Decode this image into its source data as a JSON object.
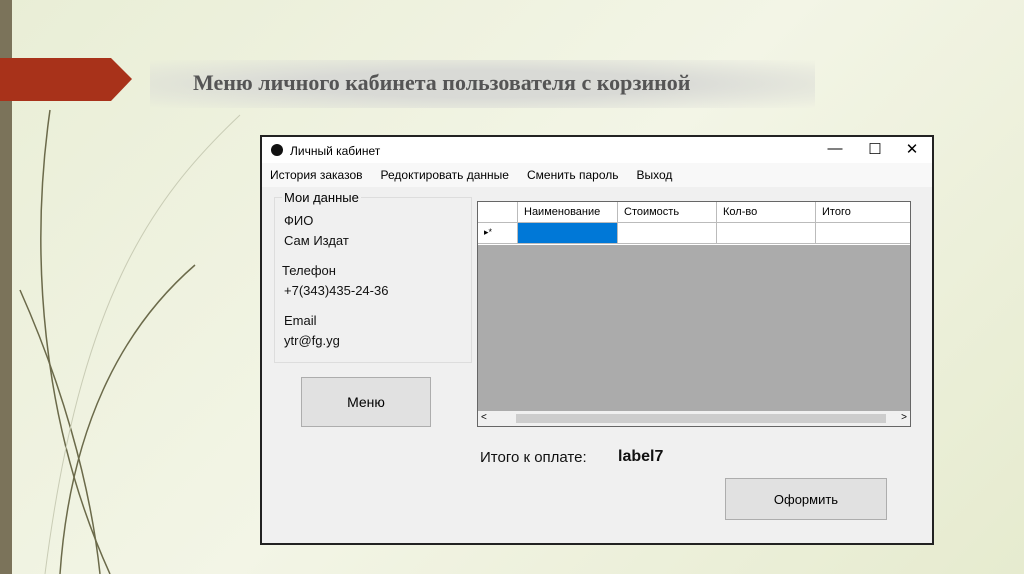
{
  "slide": {
    "title": "Меню личного кабинета пользователя с корзиной"
  },
  "window": {
    "title": "Личный кабинет",
    "minimize": "—",
    "maximize": "☐",
    "close": "✕"
  },
  "menu": [
    "История заказов",
    "Редоктировать данные",
    "Сменить пароль",
    "Выход"
  ],
  "my_data": {
    "legend": "Мои данные",
    "fio_label": "ФИО",
    "fio_value": "Сам  Издат",
    "phone_label": "Телефон",
    "phone_value": "+7(343)435-24-36",
    "email_label": "Email",
    "email_value": "ytr@fg.yg"
  },
  "menu_button": "Меню",
  "grid": {
    "columns": [
      "Наименование",
      "Стоимость",
      "Кол-во",
      "Итого"
    ],
    "new_row_marker": "▸*",
    "scroll_left": "<",
    "scroll_right": ">"
  },
  "total": {
    "label": "Итого к оплате:",
    "value": "label7"
  },
  "checkout_button": "Оформить",
  "colors": {
    "selected_cell": "#0078d7",
    "accent_arrow": "#a8321a"
  }
}
